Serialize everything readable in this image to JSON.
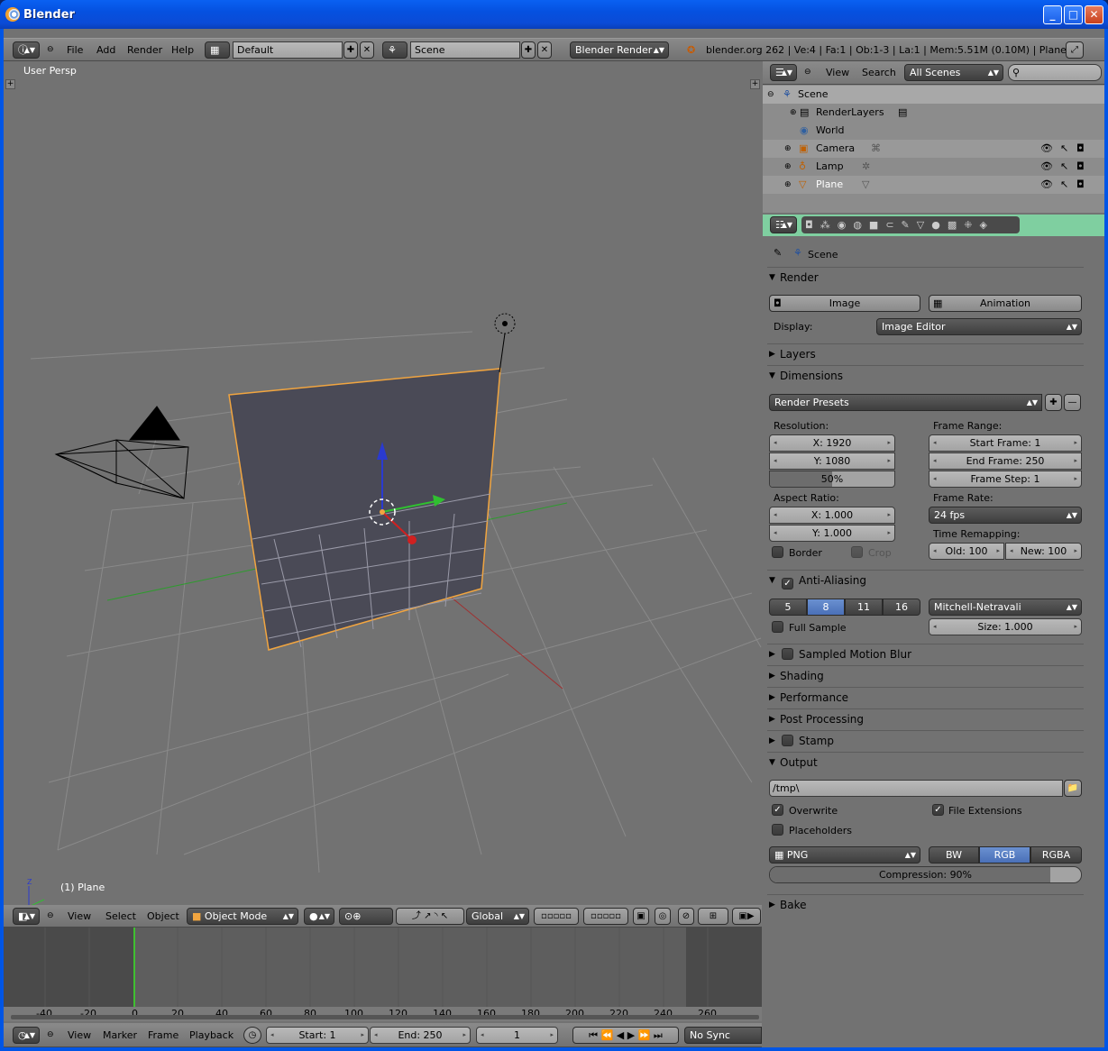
{
  "window": {
    "title": "Blender",
    "min": "_",
    "max": "□",
    "close": "✕"
  },
  "topbar": {
    "menus": [
      "File",
      "Add",
      "Render",
      "Help"
    ],
    "layout": "Default",
    "scene": "Scene",
    "engine": "Blender Render",
    "status": "blender.org 262 | Ve:4 | Fa:1 | Ob:1-3 | La:1 | Mem:5.51M (0.10M) | Plane"
  },
  "viewport": {
    "view_label": "User Persp",
    "object_label": "(1) Plane"
  },
  "view3d_header": {
    "menus": [
      "View",
      "Select",
      "Object"
    ],
    "mode": "Object Mode",
    "orientation": "Global"
  },
  "outliner": {
    "menus": [
      "View",
      "Search"
    ],
    "filter": "All Scenes",
    "items": [
      {
        "label": "Scene"
      },
      {
        "label": "RenderLayers"
      },
      {
        "label": "World"
      },
      {
        "label": "Camera"
      },
      {
        "label": "Lamp"
      },
      {
        "label": "Plane"
      }
    ]
  },
  "properties": {
    "context": "Scene",
    "render": {
      "title": "Render",
      "image": "Image",
      "animation": "Animation",
      "display_label": "Display:",
      "display": "Image Editor"
    },
    "layers": "Layers",
    "dimensions": {
      "title": "Dimensions",
      "presets": "Render Presets",
      "res_label": "Resolution:",
      "x": "X: 1920",
      "y": "Y: 1080",
      "pct": "50%",
      "pct_value": 0.5,
      "fr_label": "Frame Range:",
      "start": "Start Frame: 1",
      "end": "End Frame: 250",
      "step": "Frame Step: 1",
      "aspect_label": "Aspect Ratio:",
      "ax": "X: 1.000",
      "ay": "Y: 1.000",
      "rate_label": "Frame Rate:",
      "fps": "24 fps",
      "remap_label": "Time Remapping:",
      "old": "Old: 100",
      "new": "New: 100",
      "border": "Border",
      "crop": "Crop"
    },
    "aa": {
      "title": "Anti-Aliasing",
      "samples": [
        "5",
        "8",
        "11",
        "16"
      ],
      "selected": "8",
      "filter": "Mitchell-Netravali",
      "full_sample": "Full Sample",
      "size": "Size: 1.000"
    },
    "panels": [
      "Sampled Motion Blur",
      "Shading",
      "Performance",
      "Post Processing",
      "Stamp"
    ],
    "output": {
      "title": "Output",
      "path": "/tmp\\",
      "overwrite": "Overwrite",
      "file_ext": "File Extensions",
      "placeholders": "Placeholders",
      "format": "PNG",
      "color": [
        "BW",
        "RGB",
        "RGBA"
      ],
      "color_selected": "RGB",
      "compression": "Compression: 90%",
      "compression_value": 0.9
    },
    "bake": "Bake"
  },
  "timeline": {
    "ticks": [
      "-40",
      "-20",
      "0",
      "20",
      "40",
      "60",
      "80",
      "100",
      "120",
      "140",
      "160",
      "180",
      "200",
      "220",
      "240",
      "260"
    ],
    "menus": [
      "View",
      "Marker",
      "Frame",
      "Playback"
    ],
    "start": "Start: 1",
    "end": "End: 250",
    "current": "1",
    "sync": "No Sync"
  },
  "colors": {
    "accent": "#5680c2",
    "selection": "#f1a540",
    "header_green": "#7fcfa0"
  }
}
